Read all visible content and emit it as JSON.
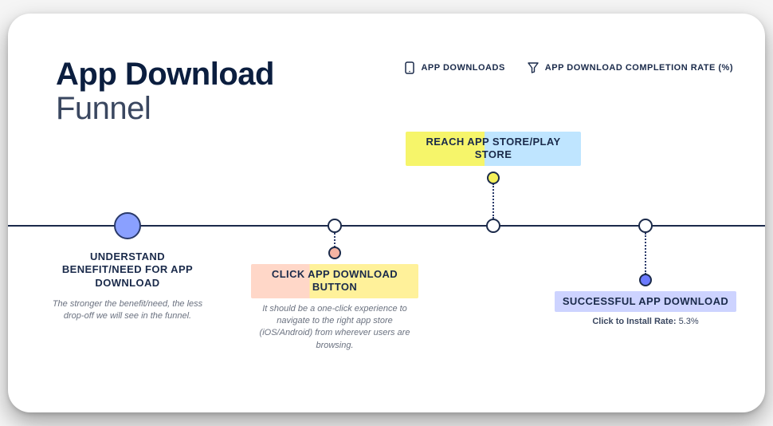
{
  "title": {
    "line1": "App Download",
    "line2": "Funnel"
  },
  "metrics": {
    "downloads_label": "APP DOWNLOADS",
    "completion_label": "APP DOWNLOAD COMPLETION RATE (%)"
  },
  "steps": {
    "understand": {
      "label": "UNDERSTAND BENEFIT/NEED FOR APP DOWNLOAD",
      "desc": "The stronger the benefit/need, the less drop-off we will see in the funnel."
    },
    "click": {
      "label": "CLICK APP DOWNLOAD BUTTON",
      "desc": "It should be a one-click experience to navigate to the right app store (iOS/Android) from wherever users are browsing."
    },
    "reach": {
      "label": "REACH APP STORE/PLAY STORE"
    },
    "success": {
      "label": "SUCCESSFUL APP DOWNLOAD",
      "metric_label": "Click to Install Rate:",
      "metric_value": "5.3%"
    }
  }
}
